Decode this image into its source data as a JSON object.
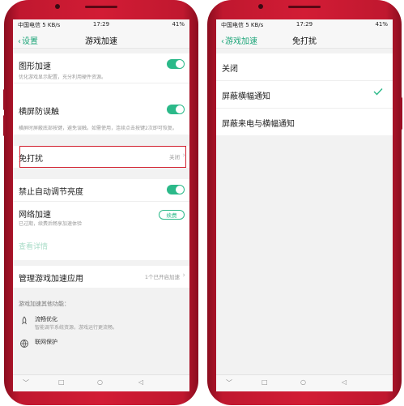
{
  "left": {
    "status": {
      "left": "中国电信 5 KB/s",
      "time": "17:29",
      "right": "41%"
    },
    "nav": {
      "back_label": "设置",
      "title": "游戏加速"
    },
    "graphics": {
      "label": "图形加速",
      "desc": "优化游戏显示配置，充分利用硬件资源。",
      "on": true
    },
    "landscape": {
      "label": "横屏防误触",
      "desc": "横屏时屏蔽底部按键，避免误触。如需使用，连续点击按键2次即可恢复。",
      "on": true
    },
    "dnd": {
      "label": "免打扰",
      "value": "关闭"
    },
    "brightness": {
      "label": "禁止自动调节亮度",
      "on": true
    },
    "network": {
      "label": "网络加速",
      "desc": "已过期，续费后畅享加速体验",
      "button": "续费",
      "details": "查看详情"
    },
    "manage": {
      "label": "管理游戏加速应用",
      "value": "1个已开启加速"
    },
    "other": {
      "title": "游戏加速其他功能：",
      "items": [
        {
          "title": "流畅优化",
          "desc": "智能调节系统资源，游戏运行更流畅。"
        },
        {
          "title": "联网保护",
          "desc": ""
        }
      ]
    }
  },
  "right": {
    "status": {
      "left": "中国电信 5 KB/s",
      "time": "17:29",
      "right": "41%"
    },
    "nav": {
      "back_label": "游戏加速",
      "title": "免打扰"
    },
    "options": [
      {
        "label": "关闭",
        "selected": false
      },
      {
        "label": "屏蔽横幅通知",
        "selected": true
      },
      {
        "label": "屏蔽来电与横幅通知",
        "selected": false
      }
    ]
  },
  "softkeys": {
    "down": "﹀",
    "square": "□",
    "circle": "○",
    "back": "◁"
  },
  "colors": {
    "accent": "#2bb989",
    "phone": "#c8192f",
    "highlight": "#d2202f"
  }
}
